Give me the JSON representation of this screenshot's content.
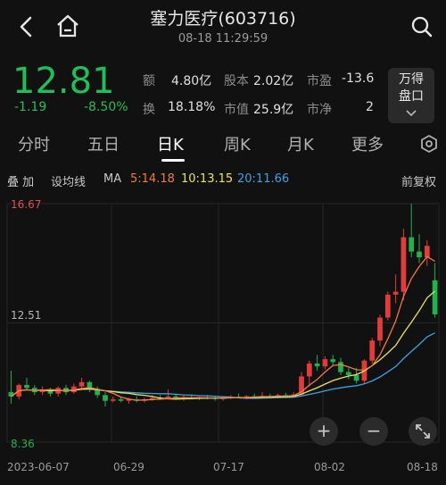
{
  "header": {
    "title": "塞力医疗(603716)",
    "datetime": "08-18 11:29:59"
  },
  "quote": {
    "price": "12.81",
    "change": "-1.19",
    "change_pct": "-8.50%",
    "stats": [
      {
        "label": "额",
        "value": "4.80亿"
      },
      {
        "label": "股本",
        "value": "2.02亿"
      },
      {
        "label": "市盈",
        "value": "-13.6"
      },
      {
        "label": "换",
        "value": "18.18%"
      },
      {
        "label": "市值",
        "value": "25.9亿"
      },
      {
        "label": "市净",
        "value": "2"
      }
    ],
    "wande_line1": "万得",
    "wande_line2": "盘口"
  },
  "tabs": [
    "分时",
    "五日",
    "日K",
    "周K",
    "月K",
    "更多"
  ],
  "active_tab": "日K",
  "indicator_bar": {
    "overlay": "叠 加",
    "settings": "设均线",
    "ma_label": "MA",
    "ma5": "5:14.18",
    "ma10": "10:13.15",
    "ma20": "20:11.66",
    "adjust": "前复权"
  },
  "colors": {
    "up": "#e03c3c",
    "down": "#22b14c",
    "ma5": "#f07b3f",
    "ma10": "#e8e35a",
    "ma20": "#3aa3e3",
    "background": "#111111"
  },
  "chart_data": {
    "type": "candlestick",
    "y_max_label": "16.67",
    "y_mid_label": "12.51",
    "y_min_label": "8.36",
    "ylim": [
      8.36,
      16.67
    ],
    "x_labels": [
      "2023-06-07",
      "06-29",
      "07-17",
      "08-02",
      "08-18"
    ],
    "candles": [
      [
        10.1,
        10.85,
        9.7,
        9.95
      ],
      [
        9.95,
        10.4,
        9.85,
        10.35
      ],
      [
        10.35,
        10.6,
        10.2,
        10.25
      ],
      [
        10.25,
        10.35,
        10.0,
        10.1
      ],
      [
        10.1,
        10.3,
        10.0,
        10.2
      ],
      [
        10.2,
        10.25,
        9.95,
        10.05
      ],
      [
        10.05,
        10.3,
        9.95,
        10.25
      ],
      [
        10.25,
        10.35,
        10.0,
        10.1
      ],
      [
        10.1,
        10.4,
        10.05,
        10.3
      ],
      [
        10.3,
        10.6,
        10.2,
        10.45
      ],
      [
        10.45,
        10.5,
        10.1,
        10.2
      ],
      [
        10.2,
        10.3,
        9.9,
        10.0
      ],
      [
        10.0,
        10.1,
        9.6,
        9.8
      ],
      [
        9.8,
        9.95,
        9.75,
        9.85
      ],
      [
        9.85,
        9.95,
        9.75,
        9.8
      ],
      [
        9.8,
        9.9,
        9.7,
        9.85
      ],
      [
        9.85,
        9.95,
        9.75,
        9.8
      ],
      [
        9.8,
        9.9,
        9.75,
        9.85
      ],
      [
        9.85,
        10.0,
        9.8,
        9.9
      ],
      [
        9.9,
        10.0,
        9.82,
        9.88
      ],
      [
        9.88,
        10.2,
        9.85,
        9.95
      ],
      [
        9.95,
        10.05,
        9.85,
        9.9
      ],
      [
        9.9,
        10.0,
        9.8,
        9.92
      ],
      [
        9.92,
        10.0,
        9.85,
        9.88
      ],
      [
        9.88,
        9.95,
        9.82,
        9.92
      ],
      [
        9.92,
        10.0,
        9.85,
        9.9
      ],
      [
        9.9,
        9.98,
        9.8,
        9.86
      ],
      [
        9.86,
        9.95,
        9.8,
        9.9
      ],
      [
        9.9,
        10.0,
        9.85,
        9.94
      ],
      [
        9.94,
        10.05,
        9.88,
        9.92
      ],
      [
        9.92,
        10.0,
        9.85,
        9.96
      ],
      [
        9.96,
        10.05,
        9.9,
        9.94
      ],
      [
        9.94,
        10.1,
        9.88,
        9.97
      ],
      [
        9.97,
        10.05,
        9.9,
        9.95
      ],
      [
        9.95,
        10.05,
        9.88,
        10.0
      ],
      [
        10.0,
        10.08,
        9.92,
        9.96
      ],
      [
        9.96,
        10.1,
        9.9,
        10.02
      ],
      [
        10.02,
        10.8,
        9.95,
        10.65
      ],
      [
        10.65,
        11.2,
        10.3,
        11.1
      ],
      [
        11.1,
        11.4,
        10.85,
        11.0
      ],
      [
        11.0,
        11.35,
        10.9,
        11.25
      ],
      [
        11.25,
        11.4,
        11.0,
        11.15
      ],
      [
        11.15,
        11.3,
        10.7,
        10.8
      ],
      [
        10.8,
        10.95,
        10.55,
        10.7
      ],
      [
        10.7,
        10.95,
        10.4,
        10.5
      ],
      [
        10.5,
        11.25,
        10.4,
        11.2
      ],
      [
        11.2,
        12.0,
        11.1,
        11.9
      ],
      [
        11.9,
        12.8,
        11.7,
        12.7
      ],
      [
        12.7,
        13.6,
        12.6,
        13.5
      ],
      [
        13.5,
        14.2,
        13.2,
        13.6
      ],
      [
        13.6,
        15.8,
        13.3,
        15.5
      ],
      [
        15.5,
        16.67,
        14.8,
        15.0
      ],
      [
        15.0,
        15.6,
        14.6,
        14.8
      ],
      [
        14.8,
        15.4,
        14.5,
        15.2
      ],
      [
        14.0,
        14.6,
        12.7,
        12.81
      ]
    ],
    "ma5_last": 14.18,
    "ma10_last": 13.15,
    "ma20_last": 11.66
  },
  "controls": {
    "zoom_in": "+",
    "zoom_out": "−"
  }
}
